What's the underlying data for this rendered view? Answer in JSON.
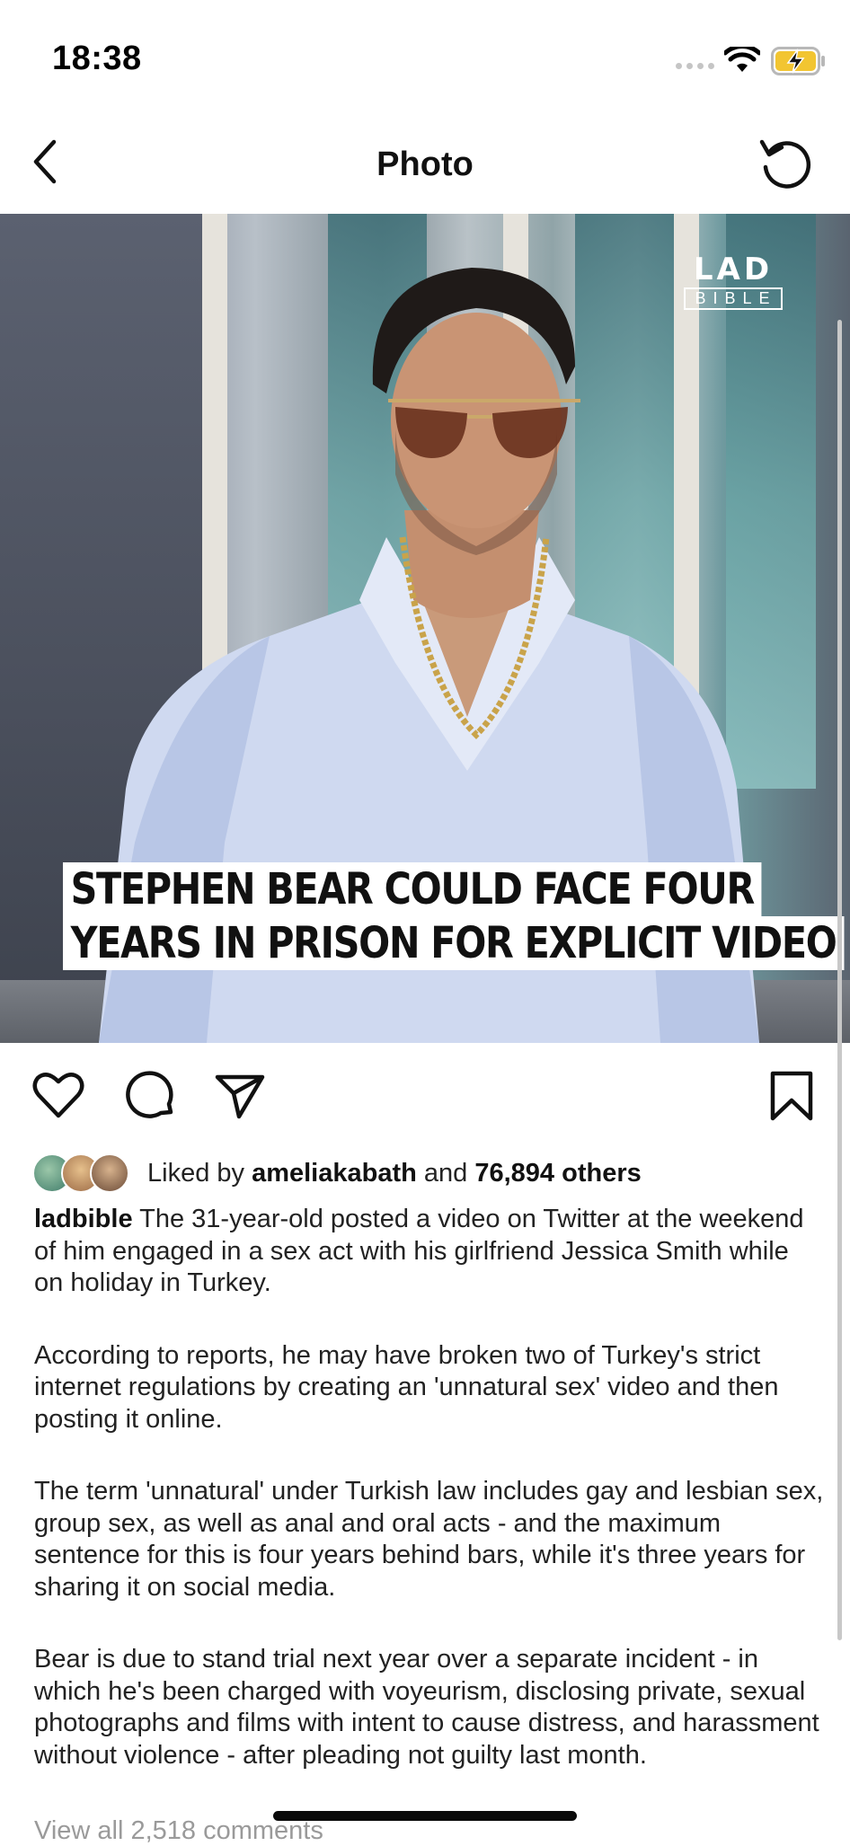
{
  "status_bar": {
    "time": "18:38"
  },
  "nav": {
    "title": "Photo"
  },
  "photo": {
    "logo_top": "LAD",
    "logo_bottom": "BIBLE",
    "headline_line1": "STEPHEN BEAR COULD FACE FOUR",
    "headline_line2": "YEARS IN PRISON FOR EXPLICIT VIDEO"
  },
  "actions": {
    "like": "heart-icon",
    "comment": "comment-icon",
    "share": "send-icon",
    "save": "bookmark-icon"
  },
  "likes": {
    "prefix": "Liked by",
    "user": "ameliakabath",
    "joiner": "and",
    "others": "76,894 others"
  },
  "caption": {
    "username": "ladbible",
    "paragraph1": "The 31-year-old posted a video on Twitter at the weekend of him engaged in a sex act with his girlfriend Jessica Smith while on holiday in Turkey.",
    "paragraph2": "According to reports, he may have broken two of Turkey's strict internet regulations by creating an 'unnatural sex' video and then posting it online.",
    "paragraph3": "The term 'unnatural' under Turkish law includes gay and lesbian sex, group sex, as well as anal and oral acts - and the maximum sentence for this is four years behind bars, while it's three years for sharing it on social media.",
    "paragraph4": "Bear is due to stand trial next year over a separate incident - in which he's been charged with voyeurism, disclosing private, sexual photographs and films with intent to cause distress, and harassment without violence - after pleading not guilty last month."
  },
  "comments": {
    "view_all": "View all 2,518 comments"
  },
  "colors": {
    "accent": "#111111",
    "muted": "#9a9a9a",
    "battery_fill": "#f2c531"
  }
}
